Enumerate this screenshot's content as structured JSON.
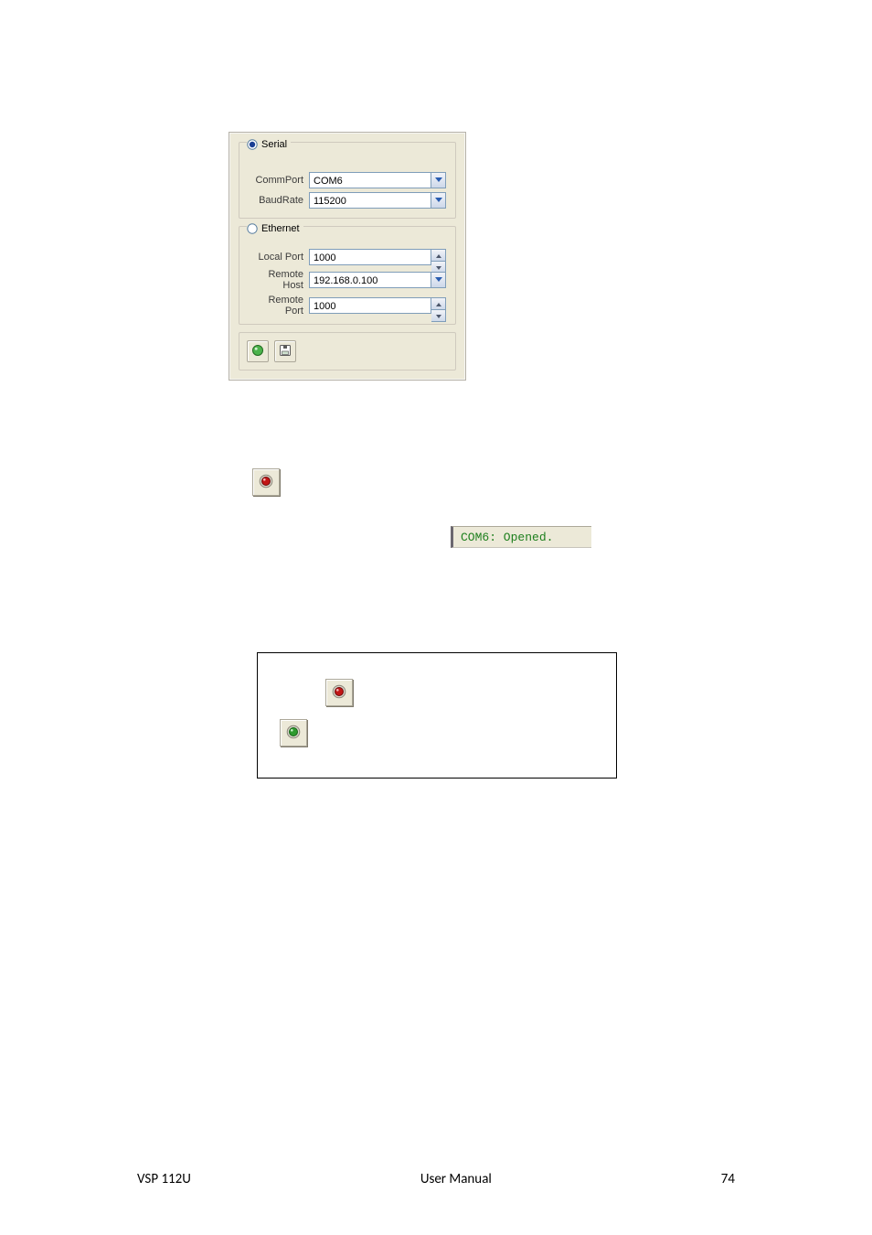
{
  "panel": {
    "serial": {
      "radio_label": "Serial",
      "selected": true,
      "commport_label": "CommPort",
      "commport_value": "COM6",
      "baudrate_label": "BaudRate",
      "baudrate_value": "115200"
    },
    "ethernet": {
      "radio_label": "Ethernet",
      "selected": false,
      "localport_label": "Local Port",
      "localport_value": "1000",
      "remotehost_label": "Remote Host",
      "remotehost_value": "192.168.0.100",
      "remoteport_label": "Remote Port",
      "remoteport_value": "1000"
    },
    "tools": {
      "connect_icon": "green-dot-icon",
      "save_icon": "save-icon"
    }
  },
  "status": {
    "text": "COM6: Opened."
  },
  "footer": {
    "left": "VSP 112U",
    "center": "User Manual",
    "right": "74"
  }
}
